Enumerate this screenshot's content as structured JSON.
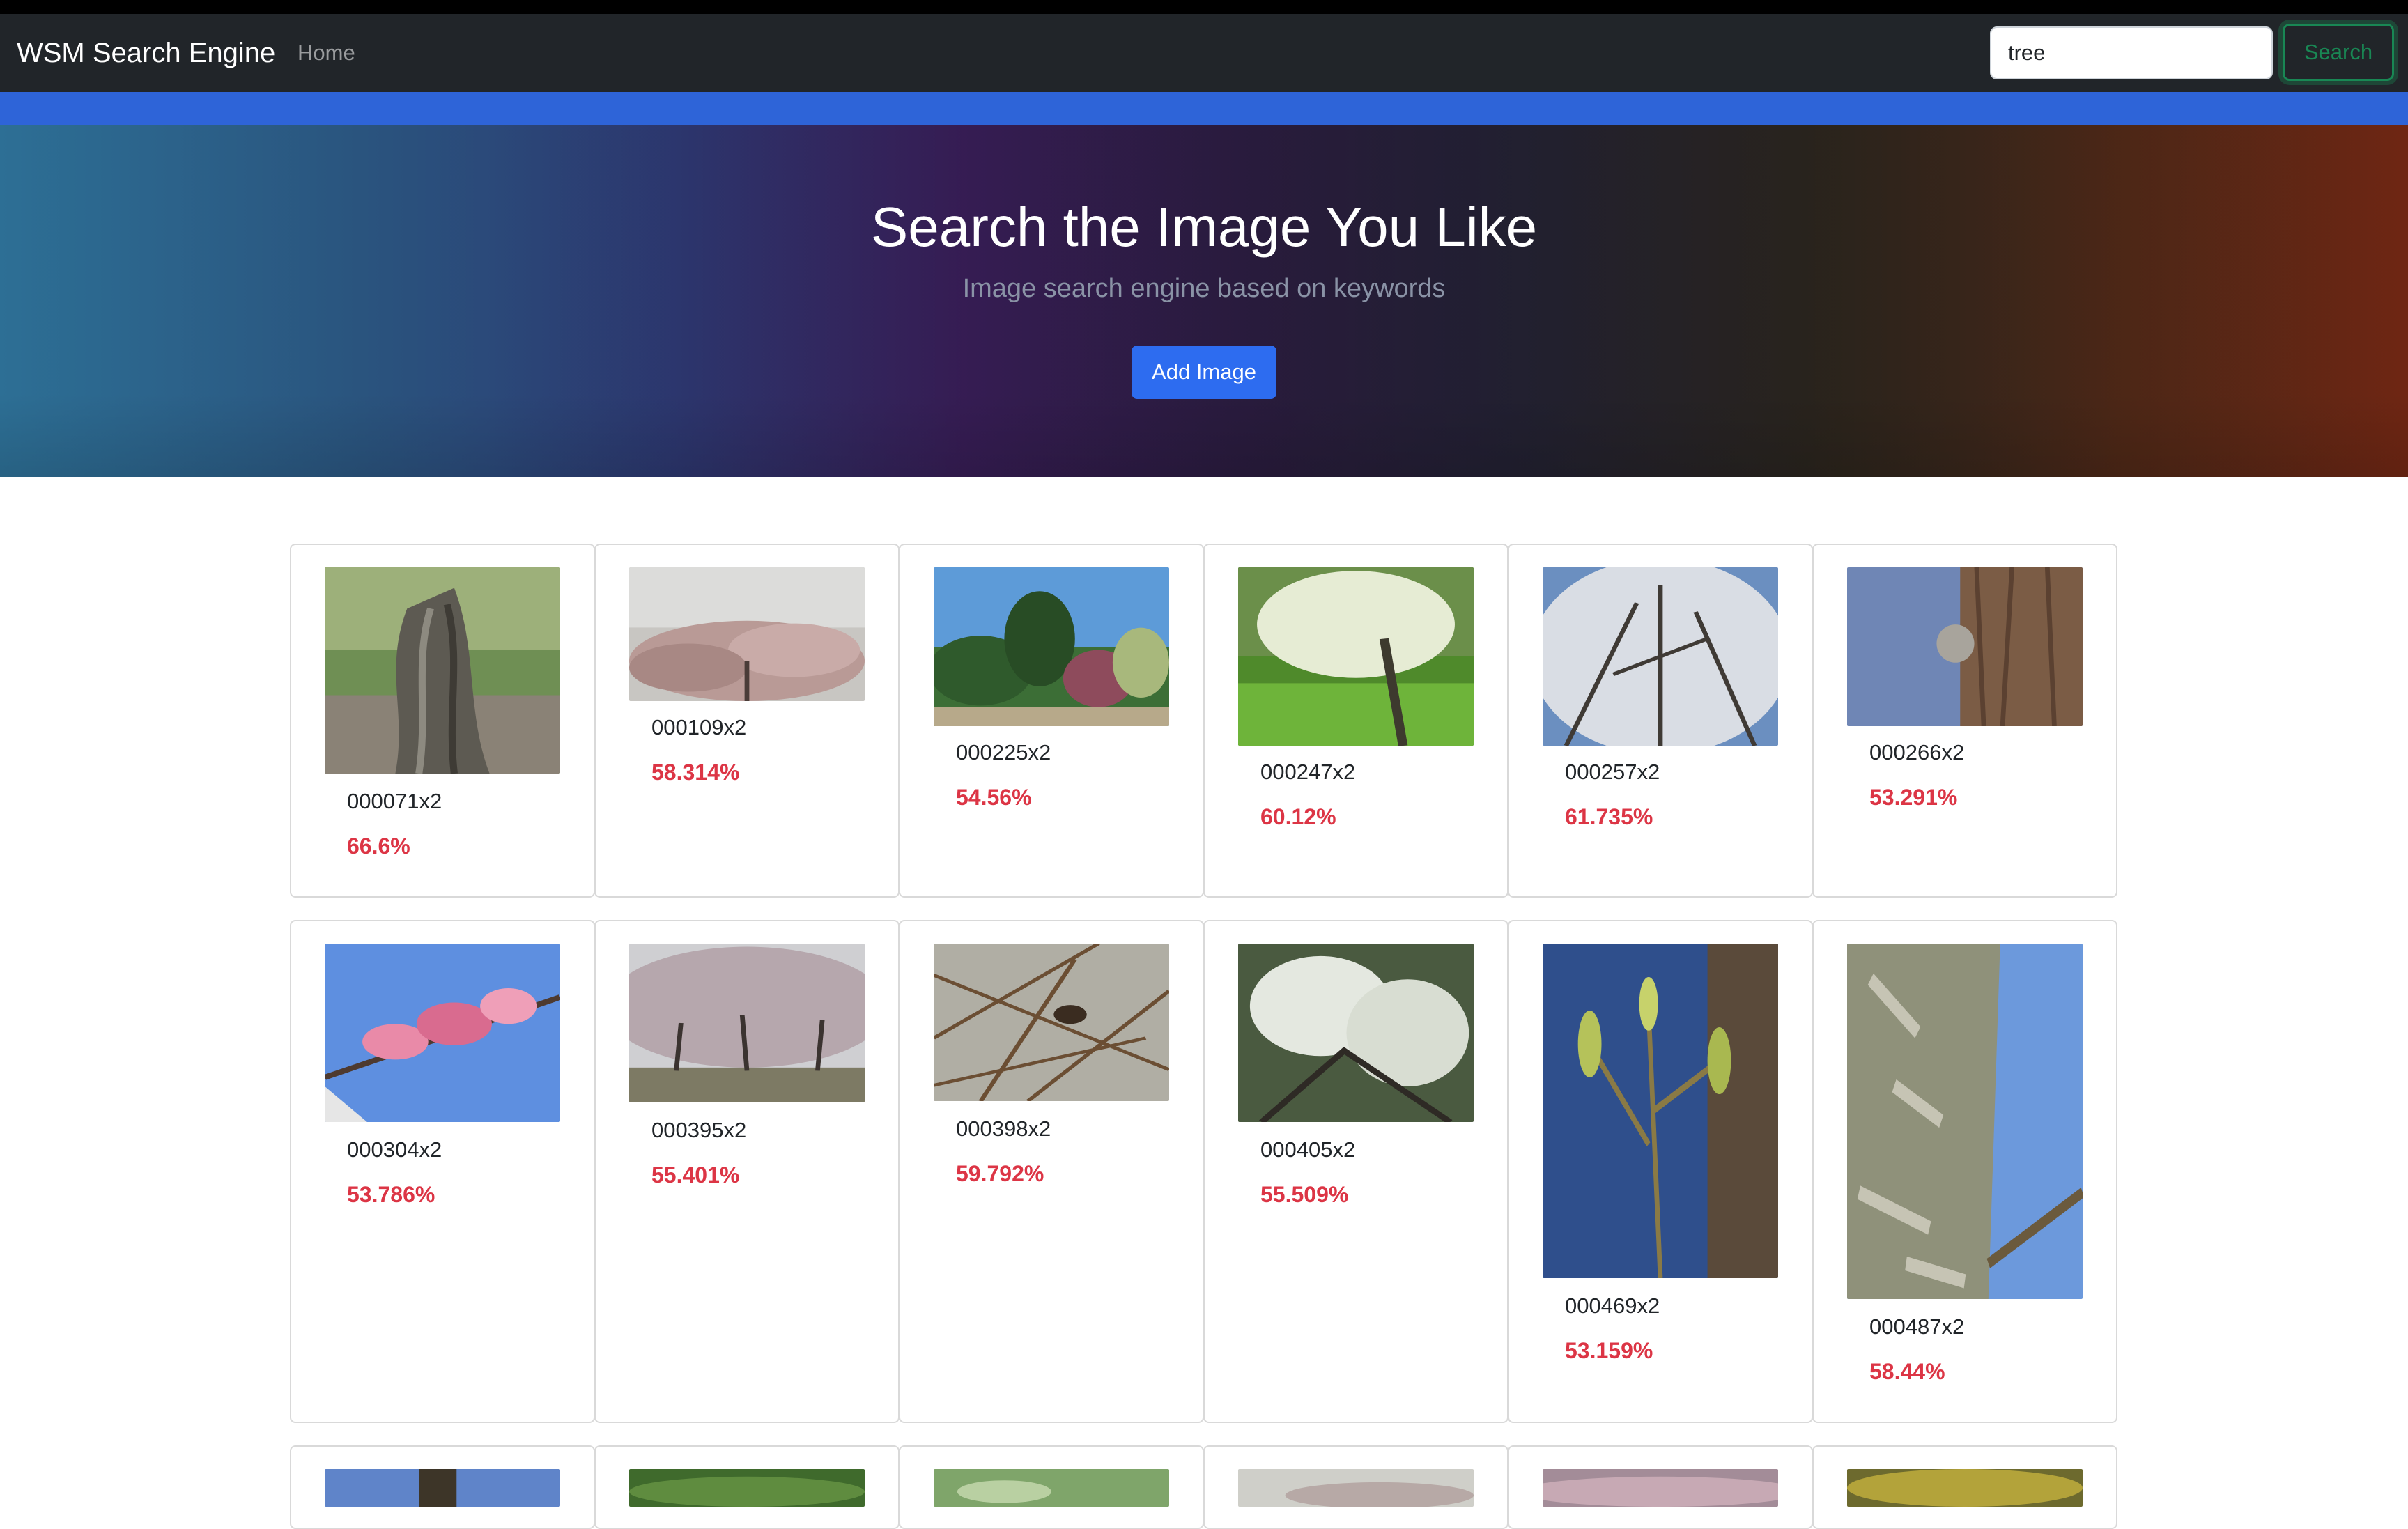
{
  "navbar": {
    "brand": "WSM Search Engine",
    "home_link": "Home",
    "search_value": "tree",
    "search_button": "Search"
  },
  "hero": {
    "title": "Search the Image You Like",
    "subtitle": "Image search engine based on keywords",
    "add_button": "Add Image"
  },
  "results": [
    {
      "name": "000071x2",
      "score": "66.6%"
    },
    {
      "name": "000109x2",
      "score": "58.314%"
    },
    {
      "name": "000225x2",
      "score": "54.56%"
    },
    {
      "name": "000247x2",
      "score": "60.12%"
    },
    {
      "name": "000257x2",
      "score": "61.735%"
    },
    {
      "name": "000266x2",
      "score": "53.291%"
    },
    {
      "name": "000304x2",
      "score": "53.786%"
    },
    {
      "name": "000395x2",
      "score": "55.401%"
    },
    {
      "name": "000398x2",
      "score": "59.792%"
    },
    {
      "name": "000405x2",
      "score": "55.509%"
    },
    {
      "name": "000469x2",
      "score": "53.159%"
    },
    {
      "name": "000487x2",
      "score": "58.44%"
    }
  ],
  "colors": {
    "navbar_bg": "#212529",
    "accent_blue": "#2e64d8",
    "score_red": "#dc3545",
    "search_green": "#198754"
  }
}
